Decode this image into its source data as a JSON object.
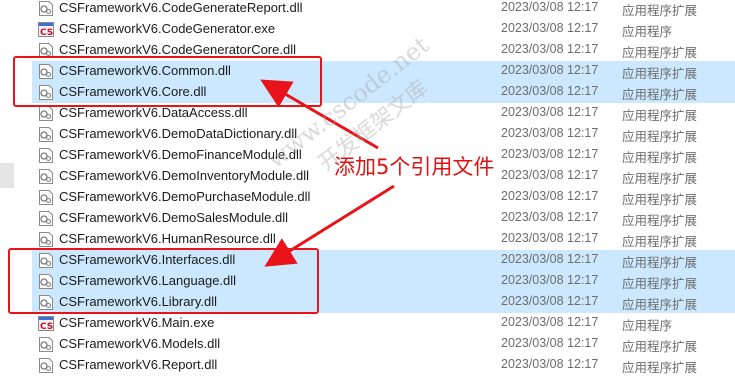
{
  "files": [
    {
      "name": "CSFrameworkV6.CodeGenerateReport.dll",
      "date": "2023/03/08 12:17",
      "type": "应用程序扩展",
      "icon": "dll-file-icon",
      "selected": false
    },
    {
      "name": "CSFrameworkV6.CodeGenerator.exe",
      "date": "2023/03/08 12:17",
      "type": "应用程序",
      "icon": "exe-app-icon",
      "selected": false
    },
    {
      "name": "CSFrameworkV6.CodeGeneratorCore.dll",
      "date": "2023/03/08 12:17",
      "type": "应用程序扩展",
      "icon": "dll-file-icon",
      "selected": false
    },
    {
      "name": "CSFrameworkV6.Common.dll",
      "date": "2023/03/08 12:17",
      "type": "应用程序扩展",
      "icon": "dll-file-icon",
      "selected": true
    },
    {
      "name": "CSFrameworkV6.Core.dll",
      "date": "2023/03/08 12:17",
      "type": "应用程序扩展",
      "icon": "dll-file-icon",
      "selected": true
    },
    {
      "name": "CSFrameworkV6.DataAccess.dll",
      "date": "2023/03/08 12:17",
      "type": "应用程序扩展",
      "icon": "dll-file-icon",
      "selected": false
    },
    {
      "name": "CSFrameworkV6.DemoDataDictionary.dll",
      "date": "2023/03/08 12:17",
      "type": "应用程序扩展",
      "icon": "dll-file-icon",
      "selected": false
    },
    {
      "name": "CSFrameworkV6.DemoFinanceModule.dll",
      "date": "2023/03/08 12:17",
      "type": "应用程序扩展",
      "icon": "dll-file-icon",
      "selected": false
    },
    {
      "name": "CSFrameworkV6.DemoInventoryModule.dll",
      "date": "2023/03/08 12:17",
      "type": "应用程序扩展",
      "icon": "dll-file-icon",
      "selected": false
    },
    {
      "name": "CSFrameworkV6.DemoPurchaseModule.dll",
      "date": "2023/03/08 12:17",
      "type": "应用程序扩展",
      "icon": "dll-file-icon",
      "selected": false
    },
    {
      "name": "CSFrameworkV6.DemoSalesModule.dll",
      "date": "2023/03/08 12:17",
      "type": "应用程序扩展",
      "icon": "dll-file-icon",
      "selected": false
    },
    {
      "name": "CSFrameworkV6.HumanResource.dll",
      "date": "2023/03/08 12:17",
      "type": "应用程序扩展",
      "icon": "dll-file-icon",
      "selected": false
    },
    {
      "name": "CSFrameworkV6.Interfaces.dll",
      "date": "2023/03/08 12:17",
      "type": "应用程序扩展",
      "icon": "dll-file-icon",
      "selected": true
    },
    {
      "name": "CSFrameworkV6.Language.dll",
      "date": "2023/03/08 12:17",
      "type": "应用程序扩展",
      "icon": "dll-file-icon",
      "selected": true
    },
    {
      "name": "CSFrameworkV6.Library.dll",
      "date": "2023/03/08 12:17",
      "type": "应用程序扩展",
      "icon": "dll-file-icon",
      "selected": true
    },
    {
      "name": "CSFrameworkV6.Main.exe",
      "date": "2023/03/08 12:17",
      "type": "应用程序",
      "icon": "exe-app-icon",
      "selected": false
    },
    {
      "name": "CSFrameworkV6.Models.dll",
      "date": "2023/03/08 12:17",
      "type": "应用程序扩展",
      "icon": "dll-file-icon",
      "selected": false
    },
    {
      "name": "CSFrameworkV6.Report.dll",
      "date": "2023/03/08 12:17",
      "type": "应用程序扩展",
      "icon": "dll-file-icon",
      "selected": false
    }
  ],
  "annotation": {
    "text": "添加5个引用文件",
    "color": "#e01010"
  },
  "watermark": {
    "line1": "www.cscode.net",
    "line2": "开发框架文库"
  },
  "colors": {
    "selection": "#cce8ff",
    "highlight_border": "#e8141a"
  }
}
